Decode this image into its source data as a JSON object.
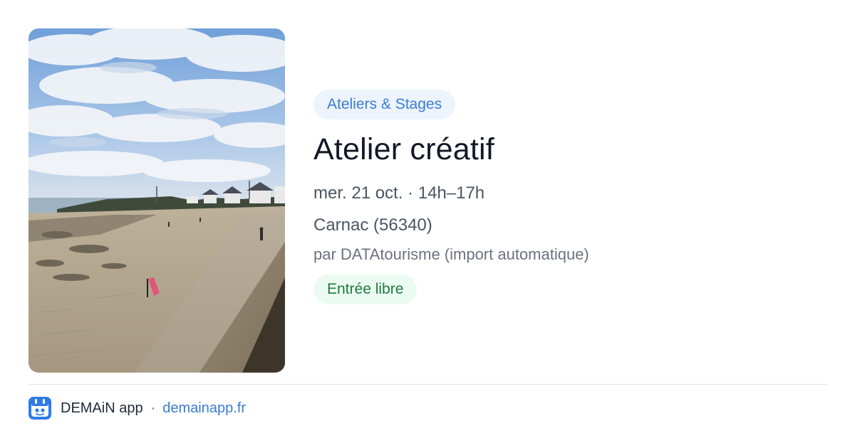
{
  "event": {
    "category": "Ateliers & Stages",
    "title": "Atelier créatif",
    "datetime": "mer. 21 oct. · 14h–17h",
    "location": "Carnac (56340)",
    "source": "par DATAtourisme (import automatique)",
    "price_badge": "Entrée libre"
  },
  "photo": {
    "subject": "beach-promenade-photo"
  },
  "footer": {
    "app_name": "DEMAiN app",
    "separator": "·",
    "site": "demainapp.fr"
  },
  "colors": {
    "accent": "#3a7bd5",
    "category_bg": "#eef4fe",
    "free_text": "#1f7a3f",
    "free_bg": "#ecfbf1",
    "title": "#111827"
  }
}
